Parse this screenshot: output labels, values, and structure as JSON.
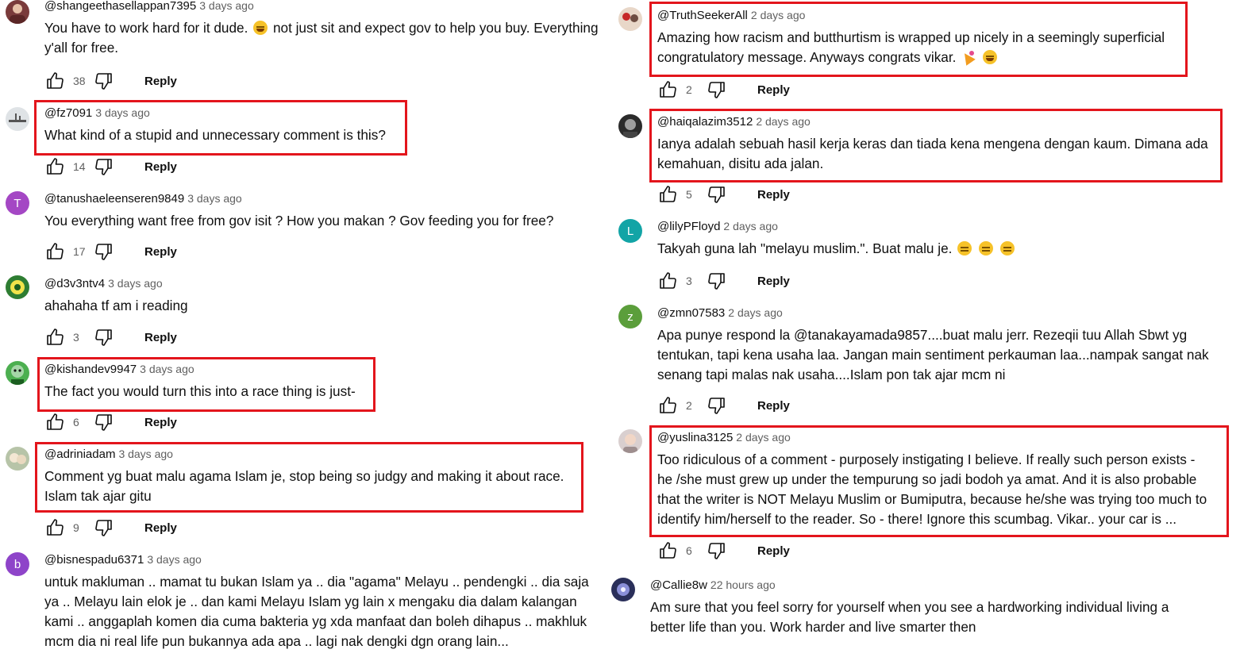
{
  "actions": {
    "reply_label": "Reply"
  },
  "colors": {
    "highlight": "#e3151c",
    "text": "#0f0f0f",
    "muted": "#606060"
  },
  "left": [
    {
      "author": "@shangeethasellappan7395",
      "time": "3 days ago",
      "avatar": {
        "type": "image",
        "bg": "#7a3b3b"
      },
      "lines": [
        "You have to work hard for it dude. [laugh] not just sit and expect gov to help you buy. Everything",
        "y'all for free."
      ],
      "likes": "38"
    },
    {
      "author": "@fz7091",
      "time": "3 days ago",
      "avatar": {
        "type": "image",
        "bg": "#dfe3e6"
      },
      "lines": [
        "What kind of a stupid and unnecessary comment is this?"
      ],
      "likes": "14"
    },
    {
      "author": "@tanushaeleenseren9849",
      "time": "3 days ago",
      "avatar": {
        "type": "letter",
        "letter": "T",
        "bg": "#a447c4"
      },
      "lines": [
        "You everything want free from gov  isit ? How you makan ? Gov feeding you for free?"
      ],
      "likes": "17"
    },
    {
      "author": "@d3v3ntv4",
      "time": "3 days ago",
      "avatar": {
        "type": "image",
        "bg": "#2e7d32"
      },
      "lines": [
        "ahahaha tf am i reading"
      ],
      "likes": "3"
    },
    {
      "author": "@kishandev9947",
      "time": "3 days ago",
      "avatar": {
        "type": "image",
        "bg": "#4caf50"
      },
      "lines": [
        "The fact you would turn this into a race thing is just-"
      ],
      "likes": "6"
    },
    {
      "author": "@adriniadam",
      "time": "3 days ago",
      "avatar": {
        "type": "image",
        "bg": "#b7c4a8"
      },
      "lines": [
        "Comment yg buat malu agama Islam je, stop being so judgy and making it about race.",
        "Islam tak ajar gitu"
      ],
      "likes": "9"
    },
    {
      "author": "@bisnespadu6371",
      "time": "3 days ago",
      "avatar": {
        "type": "letter",
        "letter": "b",
        "bg": "#8e44c9"
      },
      "lines": [
        "untuk makluman .. mamat tu bukan Islam ya .. dia \"agama\" Melayu .. pendengki .. dia saja",
        "ya .. Melayu lain elok je .. dan kami Melayu Islam yg lain x mengaku dia dalam kalangan",
        "kami .. anggaplah komen dia cuma bakteria yg xda manfaat dan boleh dihapus .. makhluk",
        "mcm dia ni real life pun bukannya ada apa .. lagi nak dengki dgn orang lain..."
      ],
      "likes": ""
    }
  ],
  "right": [
    {
      "author": "@TruthSeekerAll",
      "time": "2 days ago",
      "avatar": {
        "type": "image",
        "bg": "#e8d7c8"
      },
      "lines": [
        "Amazing how racism and butthurtism is wrapped up nicely in a seemingly superficial",
        "congratulatory message. Anyways congrats vikar. [party] [laugh]"
      ],
      "likes": "2"
    },
    {
      "author": "@haiqalazim3512",
      "time": "2 days ago",
      "avatar": {
        "type": "image",
        "bg": "#2b2b2b"
      },
      "lines": [
        "Ianya adalah sebuah hasil kerja keras dan tiada kena mengena dengan kaum. Dimana ada",
        "kemahuan, disitu ada jalan."
      ],
      "likes": "5"
    },
    {
      "author": "@lilyPFloyd",
      "time": "2 days ago",
      "avatar": {
        "type": "letter",
        "letter": "L",
        "bg": "#12a4a6"
      },
      "lines": [
        "Takyah guna lah \"melayu muslim.\".  Buat malu je. [flat] [flat] [flat]"
      ],
      "likes": "3"
    },
    {
      "author": "@zmn07583",
      "time": "2 days ago",
      "avatar": {
        "type": "letter",
        "letter": "z",
        "bg": "#5b9e3b"
      },
      "lines": [
        "Apa punye respond la @tanakayamada9857....buat malu jerr. Rezeqii tuu Allah Sbwt yg",
        "tentukan, tapi kena usaha laa. Jangan main sentiment perkauman laa...nampak sangat nak",
        "senang tapi malas nak usaha....Islam pon tak ajar mcm ni"
      ],
      "likes": "2"
    },
    {
      "author": "@yuslina3125",
      "time": "2 days ago",
      "avatar": {
        "type": "image",
        "bg": "#d9cfcf"
      },
      "lines": [
        "Too ridiculous of a comment  - purposely instigating I believe.  If really such person exists -",
        "he /she must  grew up under the tempurung so jadi bodoh ya amat.  And it is also probable",
        "that the writer is NOT Melayu Muslim or Bumiputra, because he/she was trying too much to",
        "identify him/herself to the reader.  So - there! Ignore this scumbag.  Vikar.. your car is ..."
      ],
      "likes": "6"
    },
    {
      "author": "@Callie8w",
      "time": "22 hours ago",
      "avatar": {
        "type": "image",
        "bg": "#2a2f5a"
      },
      "lines": [
        "Am sure that you feel sorry for yourself when you see a hardworking individual living a",
        "better life than you. Work harder and live smarter then"
      ],
      "likes": ""
    }
  ]
}
